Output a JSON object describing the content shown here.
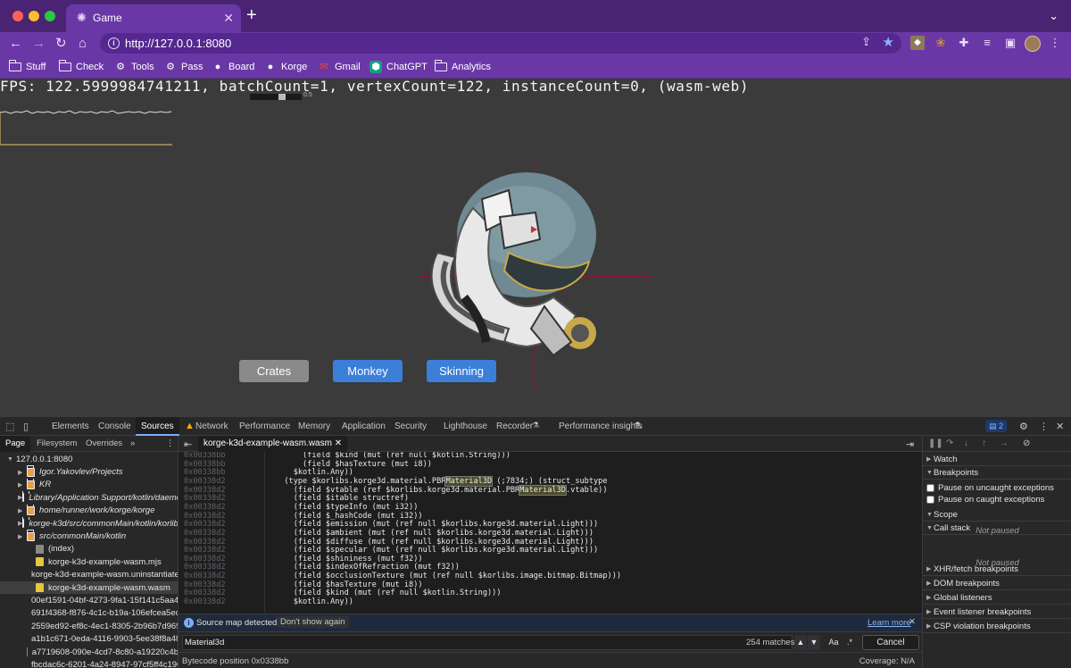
{
  "window": {
    "tab_title": "Game",
    "url": "http://127.0.0.1:8080"
  },
  "bookmarks": [
    {
      "label": "Stuff",
      "icon": "folder-icon"
    },
    {
      "label": "Check",
      "icon": "folder-icon"
    },
    {
      "label": "Tools",
      "icon": "gear-icon"
    },
    {
      "label": "Pass",
      "icon": "gear-icon"
    },
    {
      "label": "Board",
      "icon": "github-icon"
    },
    {
      "label": "Korge",
      "icon": "github-icon"
    },
    {
      "label": "Gmail",
      "icon": "gmail-icon"
    },
    {
      "label": "ChatGPT",
      "icon": "chatgpt-icon"
    },
    {
      "label": "Analytics",
      "icon": "folder-icon"
    }
  ],
  "game": {
    "stats": "FPS: 122.5999984741211, batchCount=1, vertexCount=122, instanceCount=0, (wasm-web)",
    "mini_value": "0.5",
    "buttons": [
      "Crates",
      "Monkey",
      "Skinning"
    ]
  },
  "devtools": {
    "tabs": [
      "Elements",
      "Console",
      "Sources",
      "Network",
      "Performance",
      "Memory",
      "Application",
      "Security",
      "Lighthouse",
      "Recorder",
      "Performance insights"
    ],
    "active_tab": "Sources",
    "issues_count": "2",
    "navigator_tabs": [
      "Page",
      "Filesystem",
      "Overrides"
    ],
    "tree": [
      {
        "label": "127.0.0.1:8080",
        "type": "origin"
      },
      {
        "label": "Igor.Yakovlev/Projects",
        "type": "folder"
      },
      {
        "label": "KR",
        "type": "folder"
      },
      {
        "label": "Library/Application Support/kotlin/daemon",
        "type": "folder"
      },
      {
        "label": "home/runner/work/korge/korge",
        "type": "folder"
      },
      {
        "label": "korge-k3d/src/commonMain/kotlin/korlibs",
        "type": "folder"
      },
      {
        "label": "src/commonMain/kotlin",
        "type": "folder"
      },
      {
        "label": "(index)",
        "type": "idx"
      },
      {
        "label": "korge-k3d-example-wasm.mjs",
        "type": "js"
      },
      {
        "label": "korge-k3d-example-wasm.uninstantiated.mjs",
        "type": "js"
      },
      {
        "label": "korge-k3d-example-wasm.wasm",
        "type": "js"
      },
      {
        "label": "00ef1591-04bf-4273-9fa1-15f141c5aa4b",
        "type": "gen"
      },
      {
        "label": "691f4368-f876-4c1c-b19a-106efcea5ec0",
        "type": "gen"
      },
      {
        "label": "2559ed92-ef8c-4ec1-8305-2b96b7d969",
        "type": "gen"
      },
      {
        "label": "a1b1c671-0eda-4116-9903-5ee38f8a481",
        "type": "gen"
      },
      {
        "label": "a7719608-090e-4cd7-8c80-a19220c4b",
        "type": "gen"
      },
      {
        "label": "fbcdac6c-6201-4a24-8947-97cf5ff4c196",
        "type": "gen"
      }
    ],
    "open_file": "korge-k3d-example-wasm.wasm",
    "code_lines": [
      {
        "addr": "0x00338bb",
        "code": "      (field $kind (mut (ref null $kotlin.String)))"
      },
      {
        "addr": "0x00338bb",
        "code": "      (field $hasTexture (mut i8))"
      },
      {
        "addr": "0x00338bb",
        "code": "    $kotlin.Any))"
      },
      {
        "addr": "0x00338d2",
        "code": "  (type $korlibs.korge3d.material.PBRMaterial3D (;7834;) (struct_subtype"
      },
      {
        "addr": "0x00338d2",
        "code": "    (field $vtable (ref $korlibs.korge3d.material.PBRMaterial3D.vtable))"
      },
      {
        "addr": "0x00338d2",
        "code": "    (field $itable structref)"
      },
      {
        "addr": "0x00338d2",
        "code": "    (field $typeInfo (mut i32))"
      },
      {
        "addr": "0x00338d2",
        "code": "    (field $_hashCode (mut i32))"
      },
      {
        "addr": "0x00338d2",
        "code": "    (field $emission (mut (ref null $korlibs.korge3d.material.Light)))"
      },
      {
        "addr": "0x00338d2",
        "code": "    (field $ambient (mut (ref null $korlibs.korge3d.material.Light)))"
      },
      {
        "addr": "0x00338d2",
        "code": "    (field $diffuse (mut (ref null $korlibs.korge3d.material.Light)))"
      },
      {
        "addr": "0x00338d2",
        "code": "    (field $specular (mut (ref null $korlibs.korge3d.material.Light)))"
      },
      {
        "addr": "0x00338d2",
        "code": "    (field $shininess (mut f32))"
      },
      {
        "addr": "0x00338d2",
        "code": "    (field $indexOfRefraction (mut f32))"
      },
      {
        "addr": "0x00338d2",
        "code": "    (field $occlusionTexture (mut (ref null $korlibs.image.bitmap.Bitmap)))"
      },
      {
        "addr": "0x00338d2",
        "code": "    (field $hasTexture (mut i8))"
      },
      {
        "addr": "0x00338d2",
        "code": "    (field $kind (mut (ref null $kotlin.String)))"
      },
      {
        "addr": "0x00338d2",
        "code": "    $kotlin.Any))"
      }
    ],
    "source_map_msg": "Source map detected.",
    "dont_show": "Don't show again",
    "learn_more": "Learn more",
    "search_value": "Material3d",
    "match_count": "254 matches",
    "case_label": "Aa",
    "regex_label": ".*",
    "cancel_label": "Cancel",
    "bytecode_position": "Bytecode position 0x0338bb",
    "coverage": "Coverage: N/A",
    "sidebar_sections": [
      "Watch",
      "Breakpoints",
      "Scope",
      "Call stack",
      "XHR/fetch breakpoints",
      "DOM breakpoints",
      "Global listeners",
      "Event listener breakpoints",
      "CSP violation breakpoints"
    ],
    "pause_uncaught": "Pause on uncaught exceptions",
    "pause_caught": "Pause on caught exceptions",
    "not_paused": "Not paused"
  }
}
